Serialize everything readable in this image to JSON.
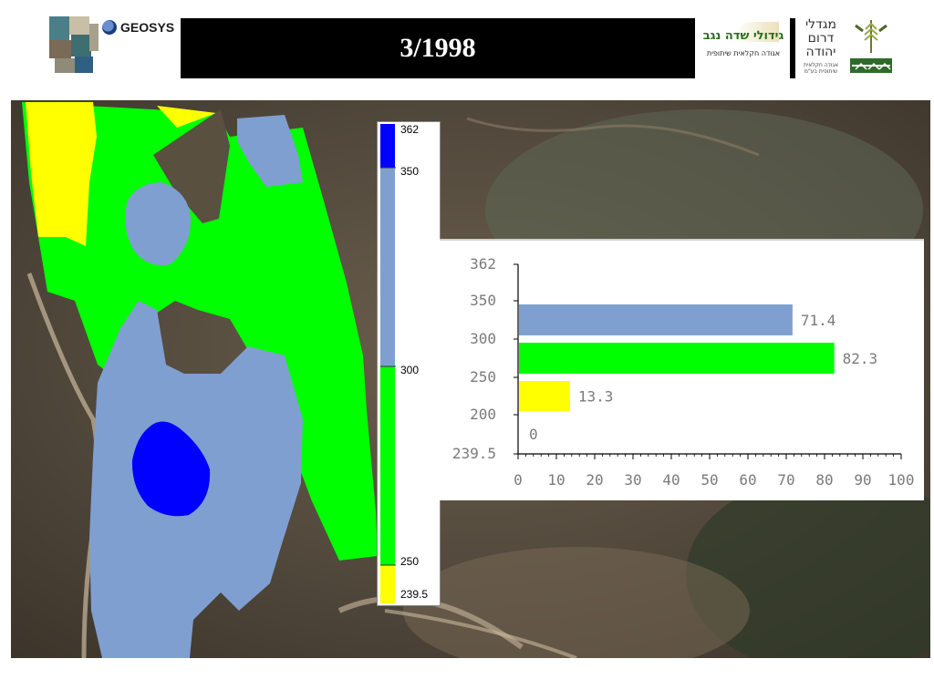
{
  "header": {
    "title": "3/1998",
    "geosys_label": "GEOSYS",
    "negev_logo_title": "גידולי שדה נגב",
    "negev_logo_subtitle": "אגודה חקלאית שיתופית",
    "darom_logo_title": "מגדלי דרום יהודה",
    "darom_logo_subtitle": "אגודה חקלאית שיתופית בע\"מ"
  },
  "colors": {
    "yellow": "#ffff00",
    "green": "#00ff00",
    "steelblue": "#7f9fd0",
    "blue": "#0000ff"
  },
  "legend": {
    "labels": [
      "362",
      "350",
      "300",
      "250",
      "239.5"
    ],
    "bands": [
      {
        "from": 350,
        "to": 362,
        "color": "#0000ff"
      },
      {
        "from": 300,
        "to": 350,
        "color": "#7f9fd0"
      },
      {
        "from": 250,
        "to": 300,
        "color": "#00ff00"
      },
      {
        "from": 239.5,
        "to": 250,
        "color": "#ffff00"
      }
    ]
  },
  "chart_data": {
    "type": "bar",
    "orientation": "horizontal",
    "title": "",
    "xlabel": "",
    "ylabel": "",
    "y_ticks": [
      "362",
      "350",
      "300",
      "250",
      "200",
      "239.5"
    ],
    "categories": [
      "362",
      "350",
      "300",
      "250"
    ],
    "values": [
      0,
      71.4,
      82.3,
      13.3
    ],
    "value_labels": [
      "0",
      "71.4",
      "82.3",
      "13.3"
    ],
    "bar_colors": [
      "#0000ff",
      "#7f9fd0",
      "#00ff00",
      "#ffff00"
    ],
    "xlim": [
      0,
      100
    ],
    "x_ticks": [
      "0",
      "10",
      "20",
      "30",
      "40",
      "50",
      "60",
      "70",
      "80",
      "90",
      "100"
    ],
    "grid": false,
    "legend": "none"
  }
}
